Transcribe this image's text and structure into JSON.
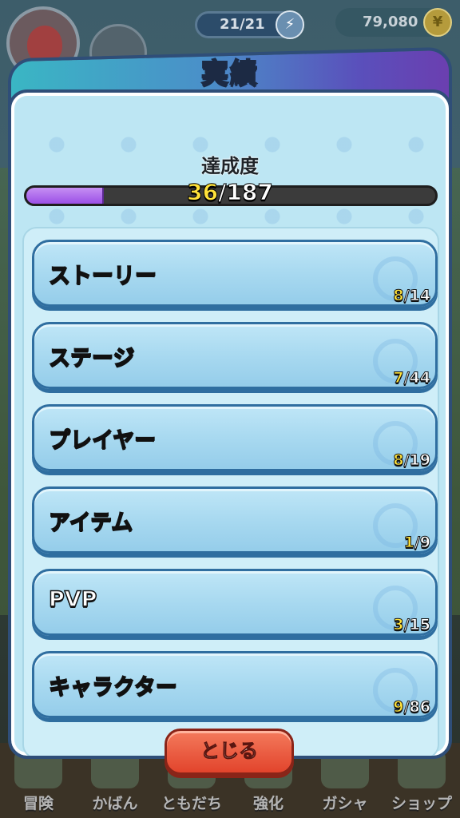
{
  "hud": {
    "energy": "21/21",
    "coins": "79,080"
  },
  "modal": {
    "title": "実績",
    "progress": {
      "label": "達成度",
      "current": "36",
      "separator": "/",
      "total": "187",
      "fraction": 0.19
    },
    "categories": [
      {
        "label": "ストーリー",
        "current": "8",
        "total": "/14"
      },
      {
        "label": "ステージ",
        "current": "7",
        "total": "/44"
      },
      {
        "label": "プレイヤー",
        "current": "8",
        "total": "/19"
      },
      {
        "label": "アイテム",
        "current": "1",
        "total": "/9"
      },
      {
        "label": "PVP",
        "current": "3",
        "total": "/15"
      },
      {
        "label": "キャラクター",
        "current": "9",
        "total": "/86"
      }
    ],
    "close_label": "とじる"
  },
  "bottom_nav": [
    {
      "label": "冒険"
    },
    {
      "label": "かばん"
    },
    {
      "label": "ともだち"
    },
    {
      "label": "強化"
    },
    {
      "label": "ガシャ"
    },
    {
      "label": "ショップ"
    }
  ],
  "colors": {
    "accent_purple": "#9b4fe6",
    "close_red": "#e2442c",
    "count_yellow": "#ffe23a"
  }
}
